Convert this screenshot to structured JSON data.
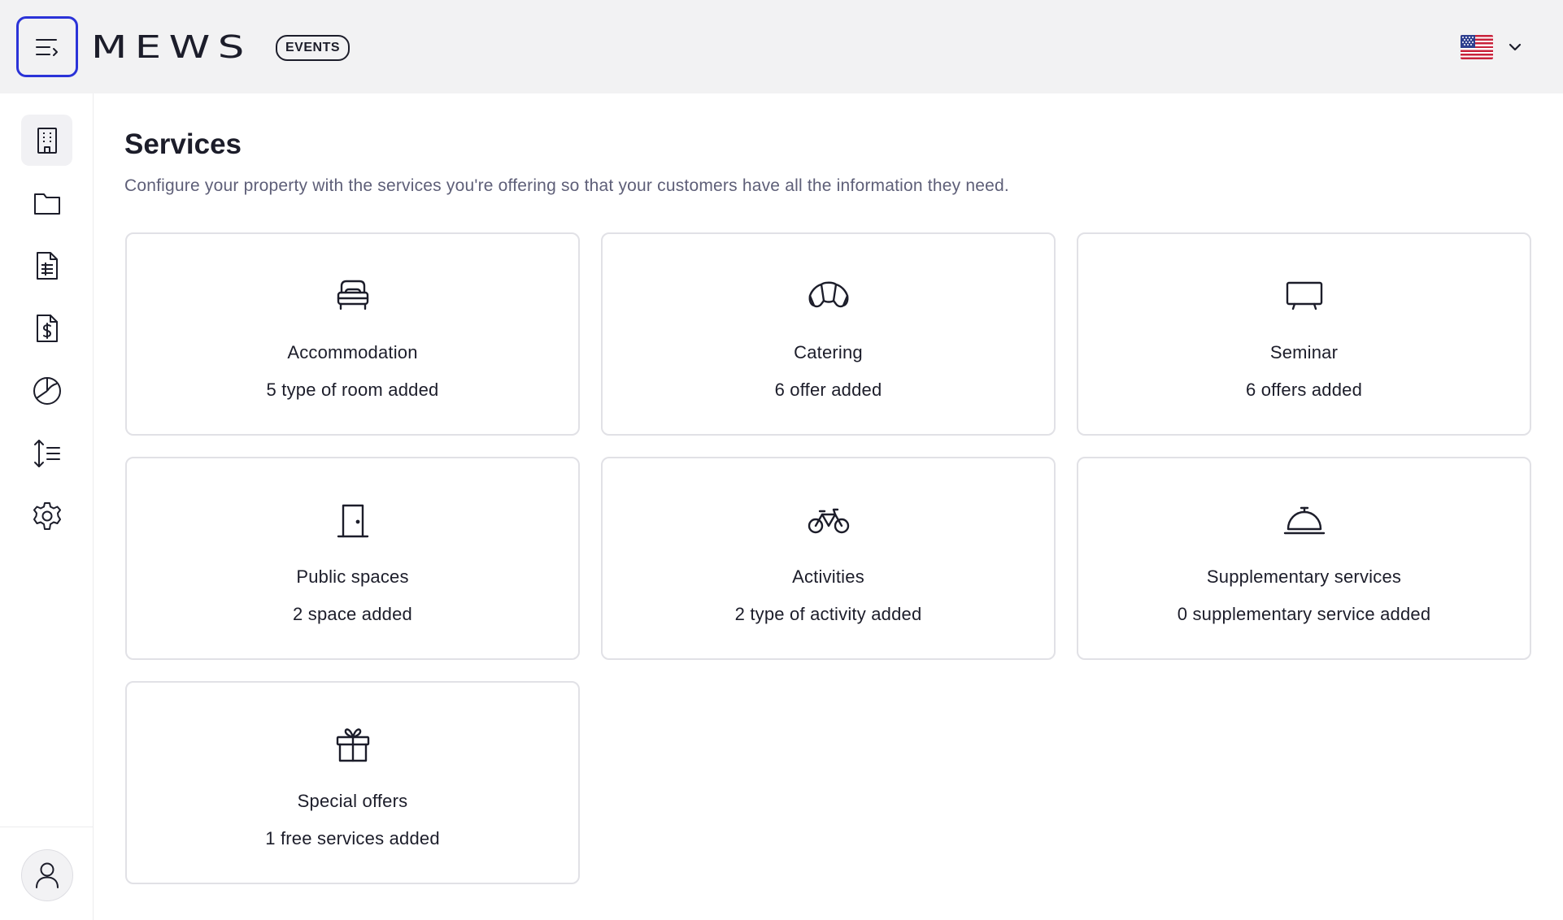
{
  "header": {
    "logo_text": "MEWS",
    "badge": "EVENTS",
    "menu_icon": "menu-collapse-icon",
    "language_flag": "us-flag-icon",
    "language_chevron": "chevron-down-icon"
  },
  "sidebar": {
    "items": [
      {
        "icon": "building-icon",
        "active": true
      },
      {
        "icon": "folder-icon",
        "active": false
      },
      {
        "icon": "document-list-icon",
        "active": false
      },
      {
        "icon": "invoice-icon",
        "active": false
      },
      {
        "icon": "pie-chart-icon",
        "active": false
      },
      {
        "icon": "sort-lines-icon",
        "active": false
      },
      {
        "icon": "gear-icon",
        "active": false
      }
    ],
    "avatar_icon": "user-icon"
  },
  "main": {
    "title": "Services",
    "subtitle": "Configure your property with the services you're offering so that your customers have all the information they need.",
    "cards": [
      {
        "title": "Accommodation",
        "subtitle": "5 type of room added",
        "icon": "bed-icon"
      },
      {
        "title": "Catering",
        "subtitle": "6 offer added",
        "icon": "croissant-icon"
      },
      {
        "title": "Seminar",
        "subtitle": "6 offers added",
        "icon": "screen-icon"
      },
      {
        "title": "Public spaces",
        "subtitle": "2 space added",
        "icon": "door-icon"
      },
      {
        "title": "Activities",
        "subtitle": "2 type of activity added",
        "icon": "bicycle-icon"
      },
      {
        "title": "Supplementary services",
        "subtitle": "0 supplementary service added",
        "icon": "service-bell-icon"
      },
      {
        "title": "Special offers",
        "subtitle": "1 free services added",
        "icon": "gift-icon"
      }
    ]
  },
  "colors": {
    "accent": "#2b33d8",
    "header_bg": "#f2f2f3",
    "text": "#1c1d2a",
    "muted_text": "#5e5f78",
    "card_border": "#e1e1e6"
  }
}
